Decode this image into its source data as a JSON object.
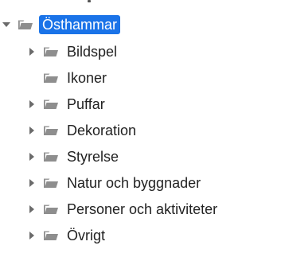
{
  "tree": {
    "root": {
      "label": "Östhammar",
      "expanded": true
    },
    "children": [
      {
        "label": "Bildspel",
        "has_children": true
      },
      {
        "label": "Ikoner",
        "has_children": false
      },
      {
        "label": "Puffar",
        "has_children": true
      },
      {
        "label": "Dekoration",
        "has_children": true
      },
      {
        "label": "Styrelse",
        "has_children": true
      },
      {
        "label": "Natur och byggnader",
        "has_children": true
      },
      {
        "label": "Personer och aktiviteter",
        "has_children": true
      },
      {
        "label": "Övrigt",
        "has_children": true
      }
    ]
  },
  "icons": {
    "expanded": "caret-down-icon",
    "collapsed": "caret-right-icon",
    "folder": "folder-open-icon"
  },
  "colors": {
    "selection": "#1a73e8",
    "folder": "#8e8e8e",
    "caret": "#6b6b6b"
  }
}
